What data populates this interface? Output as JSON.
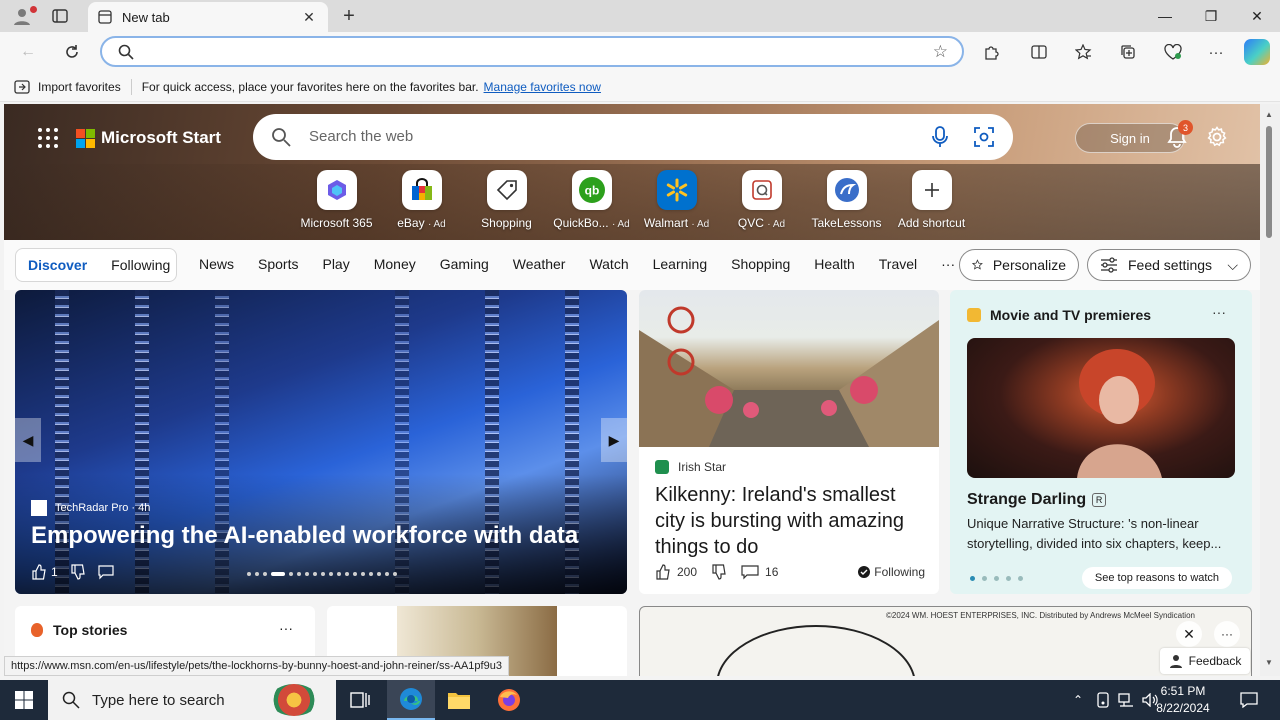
{
  "browser": {
    "tab_title": "New tab",
    "omnibox_value": "",
    "favorites_bar": {
      "import_label": "Import favorites",
      "message": "For quick access, place your favorites here on the favorites bar.",
      "link": "Manage favorites now"
    }
  },
  "hero": {
    "brand": "Microsoft Start",
    "search_placeholder": "Search the web",
    "sign_in": "Sign in",
    "notification_count": "3",
    "shortcuts": [
      {
        "label": "Microsoft 365",
        "ad": ""
      },
      {
        "label": "eBay",
        "ad": "· Ad"
      },
      {
        "label": "Shopping",
        "ad": ""
      },
      {
        "label": "QuickBo...",
        "ad": "· Ad"
      },
      {
        "label": "Walmart",
        "ad": "· Ad"
      },
      {
        "label": "QVC",
        "ad": "· Ad"
      },
      {
        "label": "TakeLessons",
        "ad": ""
      },
      {
        "label": "Add shortcut",
        "ad": ""
      }
    ]
  },
  "feed_nav": {
    "discover": "Discover",
    "following": "Following",
    "tabs": [
      "News",
      "Sports",
      "Play",
      "Money",
      "Gaming",
      "Weather",
      "Watch",
      "Learning",
      "Shopping",
      "Health",
      "Travel"
    ],
    "more": "···",
    "personalize": "Personalize",
    "feed_settings": "Feed settings"
  },
  "cards": {
    "main": {
      "source": "TechRadar Pro · 4h",
      "headline": "Empowering the AI-enabled workforce with data",
      "likes": "1"
    },
    "irish": {
      "source": "Irish Star",
      "title": "Kilkenny: Ireland's smallest city is bursting with amazing things to do",
      "likes": "200",
      "comments": "16",
      "following": "Following"
    },
    "movie": {
      "header": "Movie and TV premieres",
      "more": "···",
      "title": "Strange Darling",
      "rating": "R",
      "description": "Unique Narrative Structure: 's non-linear storytelling, divided into six chapters, keep...",
      "cta": "See top reasons to watch"
    },
    "top_stories": {
      "header": "Top stories",
      "more": "···"
    },
    "comic_caption": "©2024 WM. HOEST ENTERPRISES, INC. Distributed by Andrews McMeel Syndication",
    "feedback": "Feedback"
  },
  "status_url": "https://www.msn.com/en-us/lifestyle/pets/the-lockhorns-by-bunny-hoest-and-john-reiner/ss-AA1pf9u3",
  "taskbar": {
    "search_placeholder": "Type here to search",
    "time": "6:51 PM",
    "date": "8/22/2024"
  },
  "colors": {
    "accent": "#0f5cc0",
    "taskbar": "#1e2a3a",
    "movie_card_bg": "#e3f4f3"
  }
}
